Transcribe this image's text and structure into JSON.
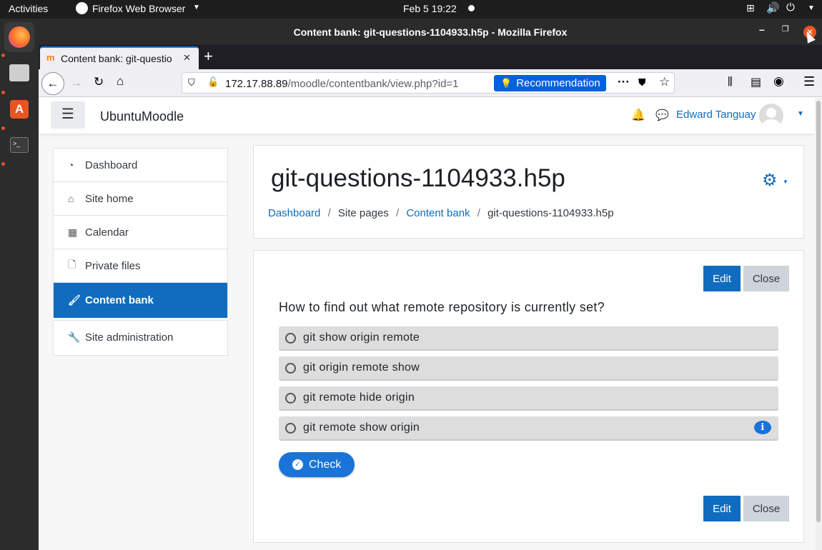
{
  "os": {
    "activities": "Activities",
    "app_menu": "Firefox Web Browser",
    "clock": "Feb 5  19:22"
  },
  "window": {
    "title": "Content bank: git-questions-1104933.h5p - Mozilla Firefox"
  },
  "browser": {
    "tab_title": "Content bank: git-questio",
    "url_host": "172.17.88.89",
    "url_path": "/moodle/contentbank/view.php?id=1",
    "recommendation": "Recommendation"
  },
  "moodle": {
    "site_name": "UbuntuMoodle",
    "user_name": "Edward Tanguay",
    "nav": [
      {
        "label": "Dashboard",
        "icon": "dashboard-icon"
      },
      {
        "label": "Site home",
        "icon": "home-icon"
      },
      {
        "label": "Calendar",
        "icon": "calendar-icon"
      },
      {
        "label": "Private files",
        "icon": "file-icon"
      },
      {
        "label": "Content bank",
        "icon": "brush-icon",
        "active": true
      }
    ],
    "admin_nav": {
      "label": "Site administration",
      "icon": "wrench-icon"
    },
    "page_title": "git-questions-1104933.h5p",
    "breadcrumb": [
      "Dashboard",
      "Site pages",
      "Content bank",
      "git-questions-1104933.h5p"
    ],
    "edit_label": "Edit",
    "close_label": "Close",
    "question": "How to find out what remote repository is currently set?",
    "options": [
      "git show origin remote",
      "git origin remote show",
      "git remote hide origin",
      "git remote show origin"
    ],
    "check_label": "Check"
  },
  "colors": {
    "primary": "#0f6cbf",
    "ubuntu_orange": "#e95420"
  }
}
